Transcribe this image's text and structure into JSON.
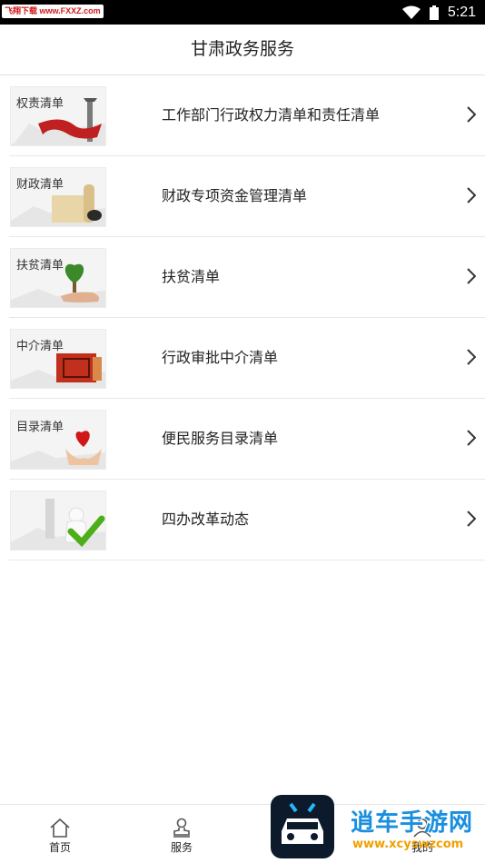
{
  "status_bar": {
    "watermark": "飞翔下载 www.FXXZ.com",
    "time": "5:21"
  },
  "header": {
    "title": "甘肃政务服务"
  },
  "list": [
    {
      "thumb_label": "权责清单",
      "title": "工作部门行政权力清单和责任清单",
      "icon": "pillar-ribbon-icon"
    },
    {
      "thumb_label": "财政清单",
      "title": "财政专项资金管理清单",
      "icon": "scroll-icon"
    },
    {
      "thumb_label": "扶贫清单",
      "title": "扶贫清单",
      "icon": "heart-tree-hand-icon"
    },
    {
      "thumb_label": "中介清单",
      "title": "行政审批中介清单",
      "icon": "red-seal-icon"
    },
    {
      "thumb_label": "目录清单",
      "title": "便民服务目录清单",
      "icon": "hands-heart-icon"
    },
    {
      "thumb_label": "",
      "title": "四办改革动态",
      "icon": "checkmark-icon"
    }
  ],
  "tabbar": {
    "home_label": "首页",
    "service_label": "服务",
    "mine_label": "我的"
  },
  "overlay": {
    "brand": "逍车手游网",
    "url": "www.xcyswzcom"
  },
  "colors": {
    "header_text": "#222222",
    "divider": "#e8e8e8",
    "watermark_red": "#d01818"
  }
}
